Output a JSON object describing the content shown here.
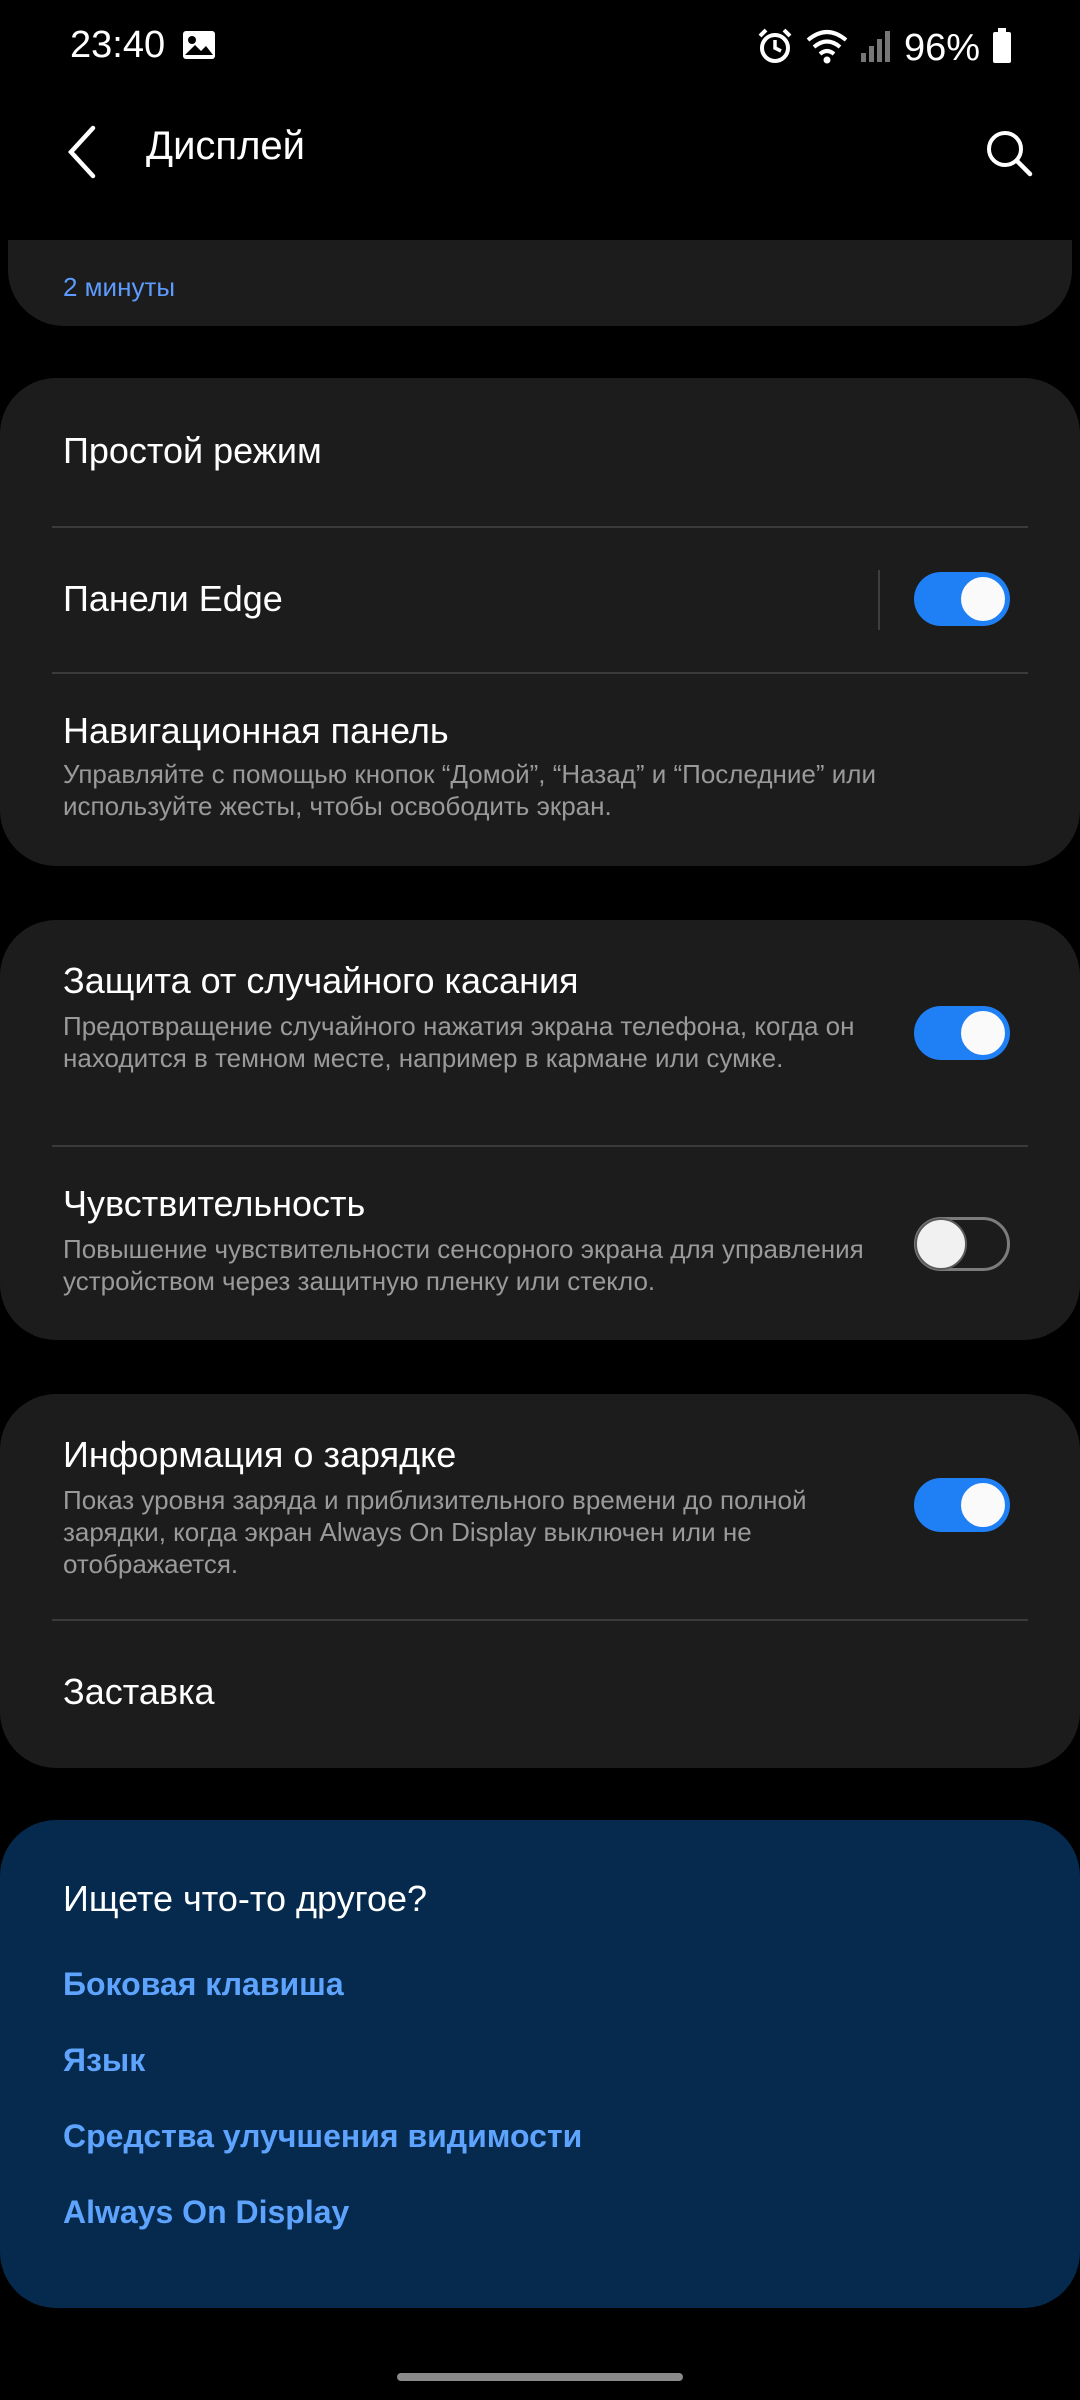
{
  "status_bar": {
    "time": "23:40",
    "battery": "96%",
    "icons": [
      "gallery-icon",
      "alarm-icon",
      "wifi-icon",
      "signal-icon",
      "battery-icon"
    ]
  },
  "header": {
    "title": "Дисплей"
  },
  "top_partial": {
    "value": "2 минуты"
  },
  "group1": {
    "easy_mode": "Простой режим",
    "edge_panels": "Панели Edge",
    "edge_panels_on": true,
    "nav_bar_title": "Навигационная панель",
    "nav_bar_sub": "Управляйте с помощью кнопок “Домой”, “Назад” и “Последние” или используйте жесты, чтобы освободить экран."
  },
  "group2": {
    "accidental_title": "Защита от случайного касания",
    "accidental_sub": "Предотвращение случайного нажатия экрана телефона, когда он находится в темном месте, например в кармане или сумке.",
    "accidental_on": true,
    "sensitivity_title": "Чувствительность",
    "sensitivity_sub": "Повышение чувствительности сенсорного экрана для управления устройством через защитную пленку или стекло.",
    "sensitivity_on": false
  },
  "group3": {
    "charging_title": "Информация о зарядке",
    "charging_sub": "Показ уровня заряда и приблизительного времени до полной зарядки, когда экран Always On Display выключен или не отображается.",
    "charging_on": true,
    "screensaver": "Заставка"
  },
  "suggestions": {
    "title": "Ищете что-то другое?",
    "links": [
      "Боковая клавиша",
      "Язык",
      "Средства улучшения видимости",
      "Always On Display"
    ]
  },
  "colors": {
    "accent": "#1f7ff4",
    "link": "#5ea4ff",
    "card": "#1c1c1c",
    "suggest_card": "#052a4e"
  }
}
